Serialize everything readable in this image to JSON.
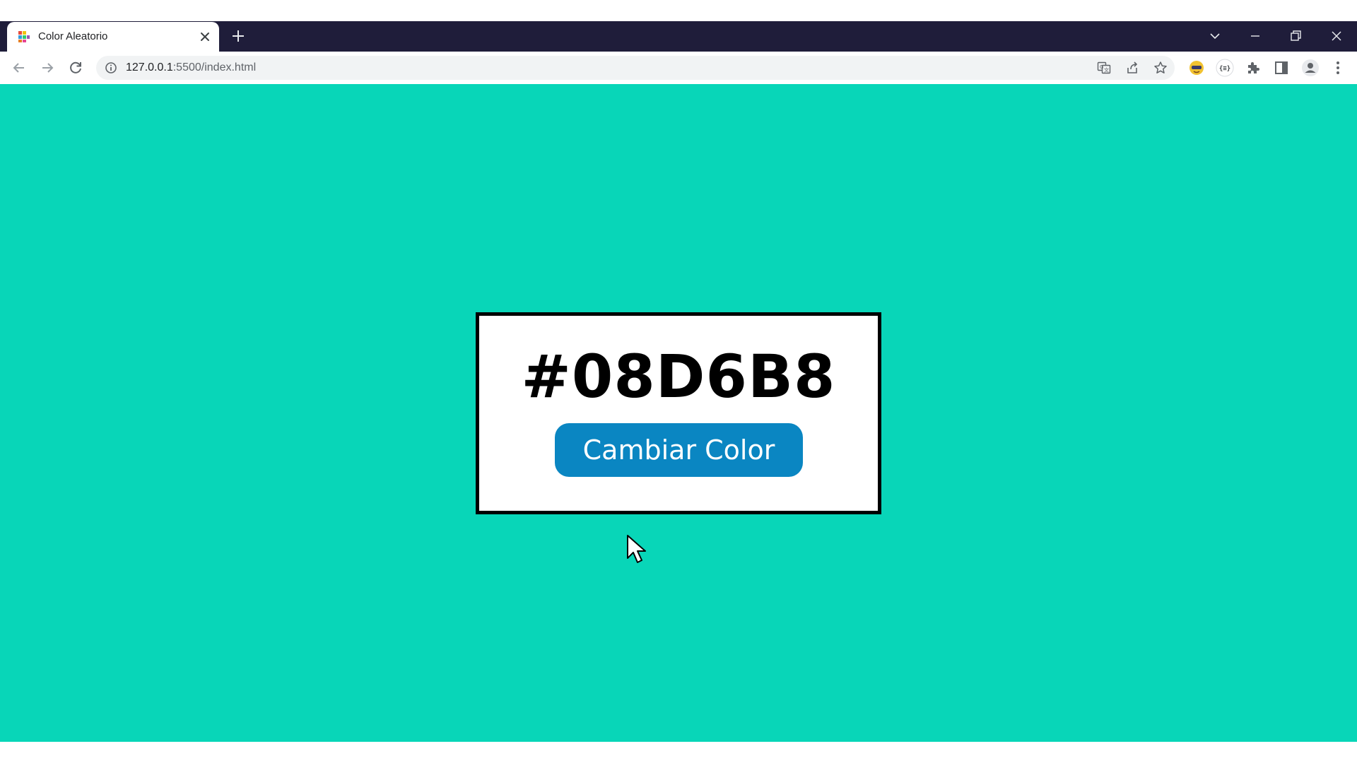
{
  "browser": {
    "tab": {
      "title": "Color Aleatorio",
      "favicon": "color-palette-icon"
    },
    "address_bar": {
      "host": "127.0.0.1",
      "path": ":5500/index.html"
    },
    "icons": {
      "back": "back-arrow-icon",
      "forward": "forward-arrow-icon",
      "reload": "reload-icon",
      "site_info": "info-icon",
      "translate": "translate-icon",
      "share": "share-icon",
      "bookmark": "star-icon",
      "extensions": "puzzle-icon",
      "side_panel": "side-panel-icon",
      "profile": "profile-icon",
      "menu": "kebab-menu-icon"
    }
  },
  "page": {
    "background_color": "#08D6B8",
    "hex_code": "#08D6B8",
    "button_label": "Cambiar Color",
    "button_color": "#0A86C2"
  },
  "colors": {
    "tabstrip": "#1F1D3A",
    "card_border": "#000000"
  }
}
